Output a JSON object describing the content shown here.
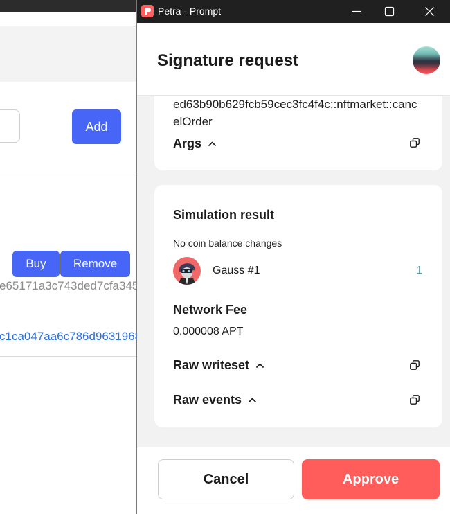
{
  "background_page": {
    "add_button_label": "Add",
    "buy_button_label": "Buy",
    "remove_button_label": "Remove",
    "hash_text": "e65171a3c743ded7cfa345",
    "link_text": "c1ca047aa6c786d9631968"
  },
  "window": {
    "title": "Petra - Prompt",
    "app_icon": "petra-logo-icon",
    "minimize_icon": "minimize-icon",
    "maximize_icon": "maximize-icon",
    "close_icon": "close-icon"
  },
  "header": {
    "title": "Signature request",
    "avatar_icon": "account-avatar"
  },
  "function_card": {
    "function_id": "ed63b90b629fcb59cec3fc4f4c::nftmarket::cancelOrder",
    "args_label": "Args",
    "expand_icon": "chevron-up-icon",
    "copy_icon": "copy-icon"
  },
  "simulation_card": {
    "title": "Simulation result",
    "balance_changes": "No coin balance changes",
    "nft": {
      "name": "Gauss #1",
      "amount": "1",
      "icon": "nft-avatar"
    },
    "network_fee": {
      "label": "Network Fee",
      "value": "0.000008 APT"
    },
    "raw_writeset": {
      "label": "Raw writeset"
    },
    "raw_events": {
      "label": "Raw events"
    }
  },
  "footer": {
    "cancel_label": "Cancel",
    "approve_label": "Approve"
  },
  "colors": {
    "primary_blue": "#4766f7",
    "approve_red": "#ff5c5c",
    "amount_teal": "#4aa0a6",
    "link_blue": "#2f6fd9",
    "titlebar": "#202020"
  }
}
